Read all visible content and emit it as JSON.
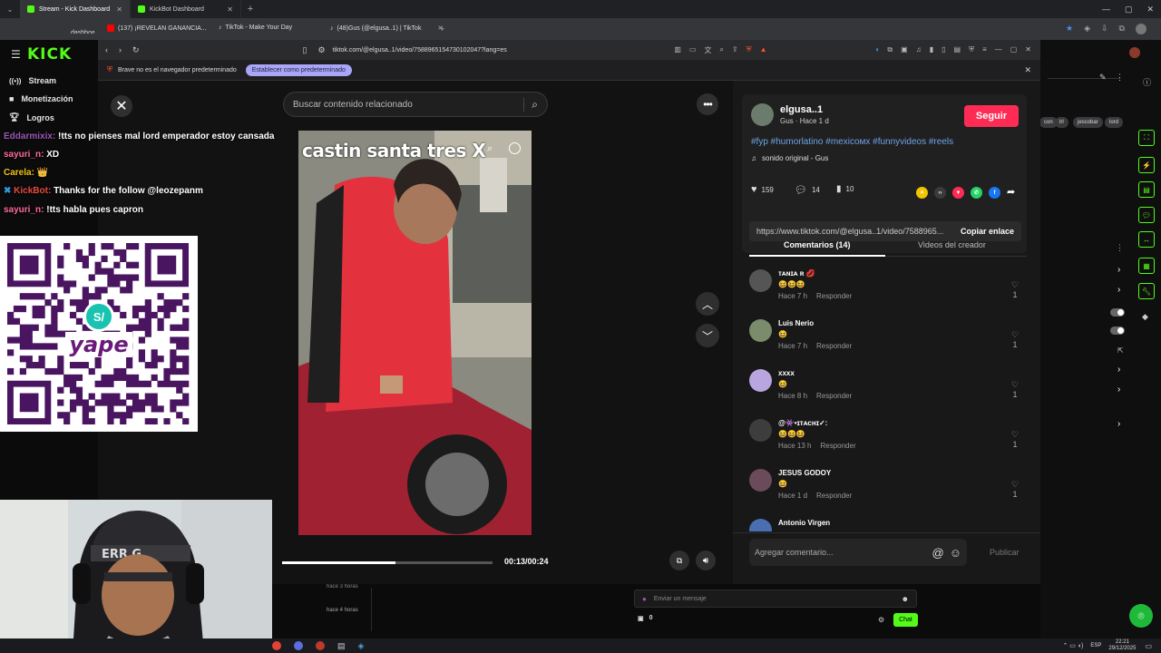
{
  "outer_tabs": [
    {
      "label": "Stream - Kick Dashboard",
      "color": "#53fc18"
    },
    {
      "label": "KickBot Dashboard",
      "color": "#53fc18"
    }
  ],
  "outer_bookmarks": [
    {
      "label": "dashboar",
      "color": "#53fc18"
    },
    {
      "label": "(137) ¡REVELAN GANANCIA...",
      "color": "#ff0000"
    },
    {
      "label": "TikTok - Make Your Day",
      "color": "#111111"
    },
    {
      "label": "(48)Gus (@elgusa..1) | TikTok",
      "color": "#111111"
    }
  ],
  "kick": {
    "logo": "KICK",
    "nav": [
      {
        "label": "Stream",
        "icon": "signal-icon"
      },
      {
        "label": "Monetización",
        "icon": "money-icon"
      },
      {
        "label": "Logros",
        "icon": "trophy-icon"
      }
    ],
    "chat_lines": [
      {
        "user": "Eddarmixix:",
        "msg": "!tts no pienses mal lord emperador estoy cansada",
        "color": "#9b59b6"
      },
      {
        "user": "sayuri_n:",
        "msg": "XD",
        "color": "#ff6b9d"
      },
      {
        "user": "Carela:",
        "msg": "👑",
        "color": "#f1c40f"
      },
      {
        "user": "KickBot:",
        "msg": "Thanks for the follow @leozepanm",
        "color": "#e74c3c"
      },
      {
        "user": "sayuri_n:",
        "msg": "!tts habla pues capron",
        "color": "#ff6b9d"
      }
    ],
    "qr_brand": "yape",
    "right_tags": [
      "con",
      "lrl",
      "jescobar",
      "lord"
    ],
    "bottom": {
      "times": [
        "hace 3 horas",
        "hace 4 horas"
      ],
      "chat_placeholder": "Enviar un mensaje",
      "viewer_count": "0",
      "chat_button": "Chat"
    }
  },
  "inner_browser": {
    "url": "tiktok.com/@elgusa..1/video/7588965154730102047?lang=es",
    "notice": "Brave no es el navegador predeterminado",
    "notice_button": "Establecer como predeterminado"
  },
  "tiktok": {
    "search_placeholder": "Buscar contenido relacionado",
    "video_caption": "castin santa tres X",
    "time": "00:13/00:24",
    "progress_fraction": 0.54,
    "author": {
      "handle": "elgusa..1",
      "sub": "Gus · Hace 1 d",
      "follow": "Seguir"
    },
    "hashtags": "#fyp #humorlatino #mexicoмx #funnyvideos #reels",
    "sound": "sonido original - Gus",
    "stats": {
      "likes": "159",
      "comments": "14",
      "saves": "10"
    },
    "share_colors": [
      "#f5c400",
      "#3a3a3a",
      "#fe2c55",
      "#25d366",
      "#1877f2"
    ],
    "link": "https://www.tiktok.com/@elgusa..1/video/7588965...",
    "copy_link": "Copiar enlace",
    "tab_comments": "Comentarios (14)",
    "tab_videos": "Videos del creador",
    "comments": [
      {
        "name": "ᴛᴀɴɪᴀ ʀ 💋",
        "emoji": "😆😆😆",
        "time": "Hace 7 h",
        "reply": "Responder",
        "likes": "1"
      },
      {
        "name": "Luis Nerio",
        "emoji": "😆",
        "time": "Hace 7 h",
        "reply": "Responder",
        "likes": "1"
      },
      {
        "name": "xxxx",
        "emoji": "😆",
        "time": "Hace 8 h",
        "reply": "Responder",
        "likes": "1"
      },
      {
        "name": "@👾•ɪᴛᴀᴄʜɪ✓:",
        "emoji": "😆😆😆",
        "time": "Hace 13 h",
        "reply": "Responder",
        "likes": "1"
      },
      {
        "name": "JESUS GODOY",
        "emoji": "😆",
        "time": "Hace 1 d",
        "reply": "Responder",
        "likes": "1"
      },
      {
        "name": "Antonio Virgen",
        "emoji": "😆😆😆",
        "time": "",
        "reply": "",
        "likes": ""
      }
    ],
    "comment_placeholder": "Agregar comentario...",
    "publish": "Publicar"
  },
  "taskbar": {
    "lang": "ESP",
    "time": "22:21",
    "date": "29/12/2025"
  }
}
